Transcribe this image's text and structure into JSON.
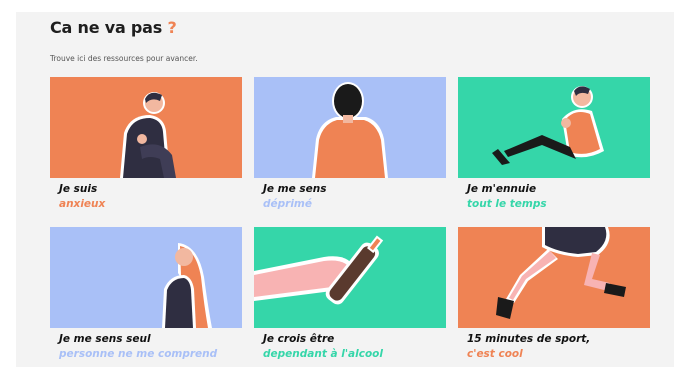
{
  "header": {
    "title": "Ca ne va pas",
    "title_mark": "?",
    "subtitle": "Trouve ici des ressources pour avancer."
  },
  "colors": {
    "orange": "#ef8354",
    "blue": "#a9c0f7",
    "green": "#35d6a9",
    "dark": "#2f2e41"
  },
  "cards": [
    {
      "line1": "Je suis",
      "line2": "anxieux",
      "accent": "#ef8354",
      "bg": "#ef8354",
      "icon": "sitting-person-icon"
    },
    {
      "line1": "Je me sens",
      "line2": "déprimé",
      "accent": "#a9c0f7",
      "bg": "#a9c0f7",
      "icon": "person-back-icon"
    },
    {
      "line1": "Je m'ennuie",
      "line2": "tout le temps",
      "accent": "#35d6a9",
      "bg": "#35d6a9",
      "icon": "lounging-person-icon"
    },
    {
      "line1": "Je me sens seul",
      "line2": "personne ne me comprend",
      "accent": "#a9c0f7",
      "bg": "#a9c0f7",
      "icon": "lonely-person-icon"
    },
    {
      "line1": "Je crois être",
      "line2": "dependant à l'alcool",
      "accent": "#35d6a9",
      "bg": "#35d6a9",
      "icon": "bottle-hand-icon"
    },
    {
      "line1": "15 minutes de sport,",
      "line2": "c'est cool",
      "accent": "#ef8354",
      "bg": "#ef8354",
      "icon": "running-legs-icon"
    }
  ]
}
